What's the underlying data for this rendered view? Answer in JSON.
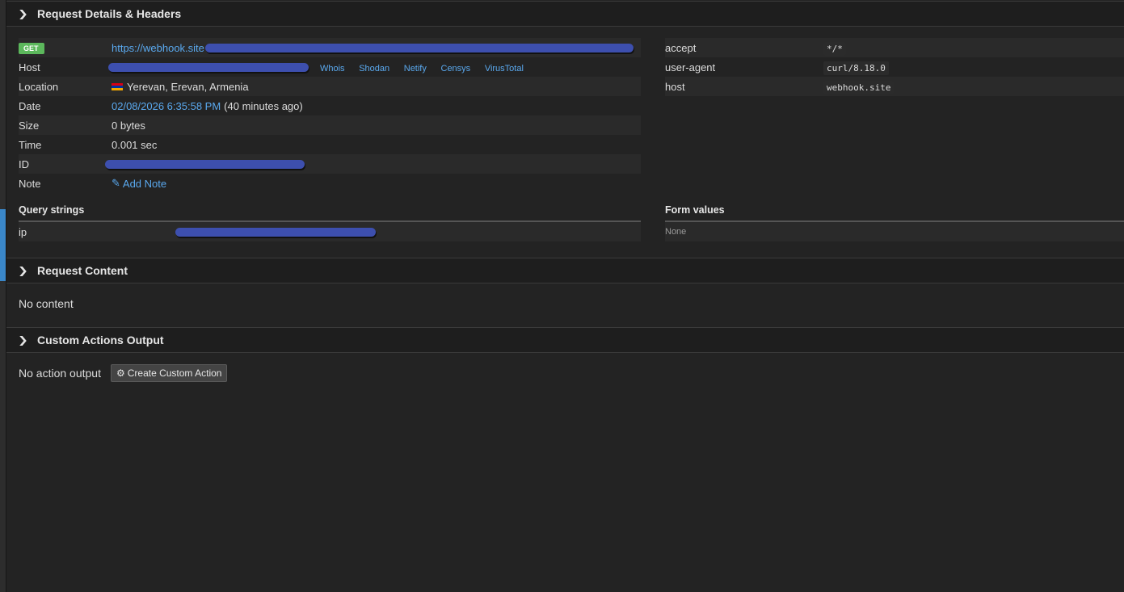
{
  "sections": {
    "request_details": "Request Details & Headers",
    "request_content": "Request Content",
    "custom_actions": "Custom Actions Output"
  },
  "details": {
    "method": "GET",
    "url_prefix": "https://webhook.site",
    "labels": {
      "host": "Host",
      "location": "Location",
      "date": "Date",
      "size": "Size",
      "time": "Time",
      "id": "ID",
      "note": "Note"
    },
    "host_links": [
      "Whois",
      "Shodan",
      "Netify",
      "Censys",
      "VirusTotal"
    ],
    "location": "Yerevan, Erevan, Armenia",
    "date_link": "02/08/2026 6:35:58 PM",
    "date_relative": "(40 minutes ago)",
    "size": "0 bytes",
    "time": "0.001 sec",
    "note_link": "Add Note"
  },
  "headers": [
    {
      "name": "accept",
      "value": "*/*"
    },
    {
      "name": "user-agent",
      "value": "curl/8.18.0"
    },
    {
      "name": "host",
      "value": "webhook.site"
    }
  ],
  "query_strings": {
    "title": "Query strings",
    "rows": [
      {
        "name": "ip"
      }
    ]
  },
  "form_values": {
    "title": "Form values",
    "empty": "None"
  },
  "content": {
    "empty": "No content"
  },
  "actions": {
    "empty": "No action output",
    "button": "Create Custom Action"
  },
  "colors": {
    "background": "#232323",
    "link": "#5aa9ef",
    "get_badge": "#5cb85c",
    "redaction": "#3d4fae",
    "rail_accent": "#3a87c9"
  }
}
